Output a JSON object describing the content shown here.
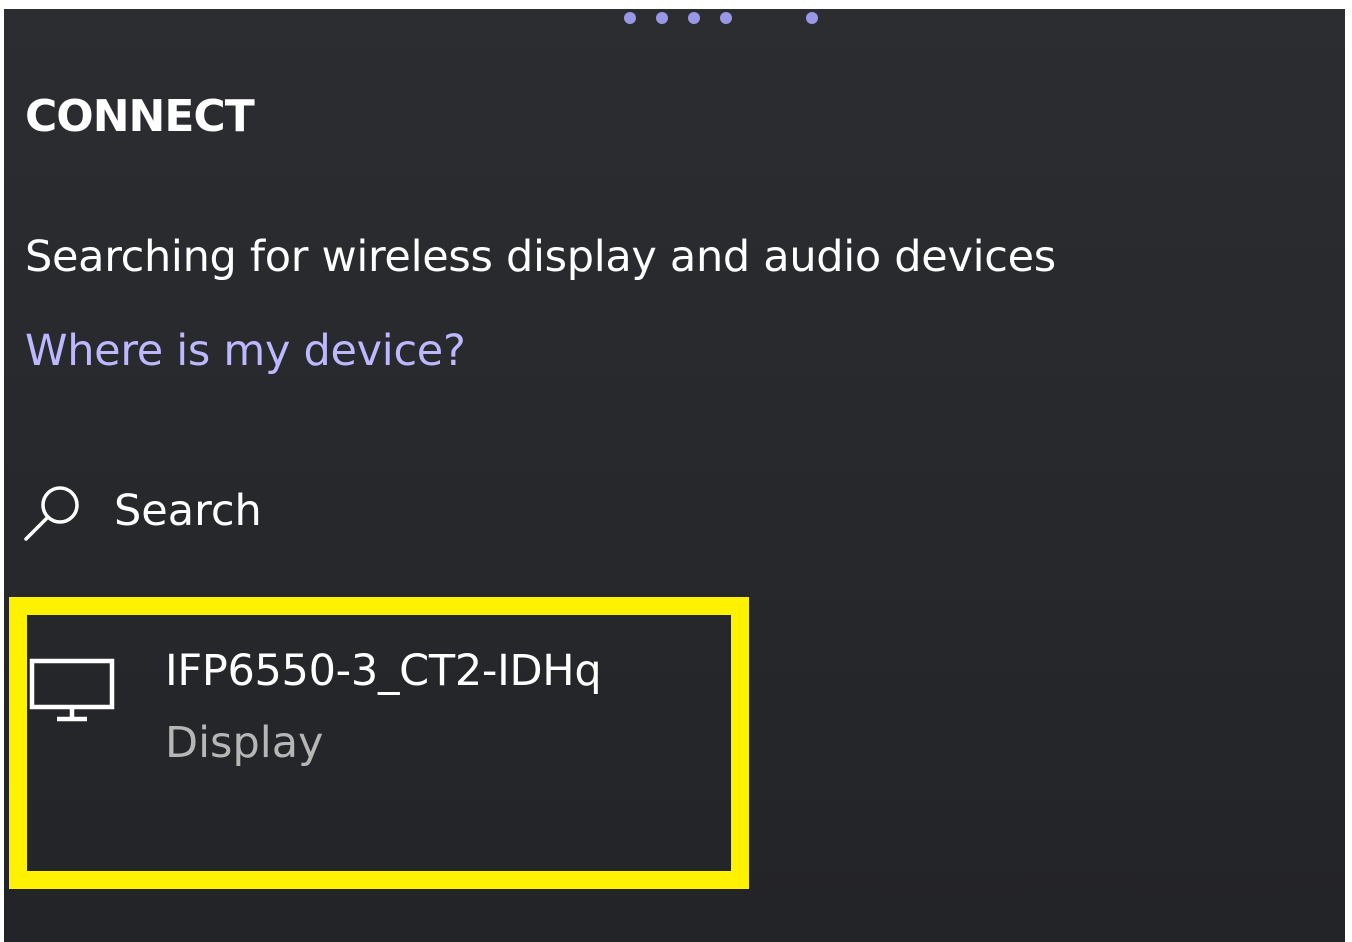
{
  "connect": {
    "title": "CONNECT",
    "status": "Searching for wireless display and audio devices",
    "help_link": "Where is my device?",
    "search_label": "Search",
    "devices": [
      {
        "name": "IFP6550-3_CT2-IDHq",
        "type": "Display",
        "icon": "monitor-icon",
        "highlighted": true
      }
    ]
  },
  "colors": {
    "background": "#2a2b2f",
    "text": "#ffffff",
    "link": "#bdb8ff",
    "secondary_text": "#b6b6b6",
    "progress_dots": "#9a97e6",
    "highlight_border": "#fff200"
  }
}
